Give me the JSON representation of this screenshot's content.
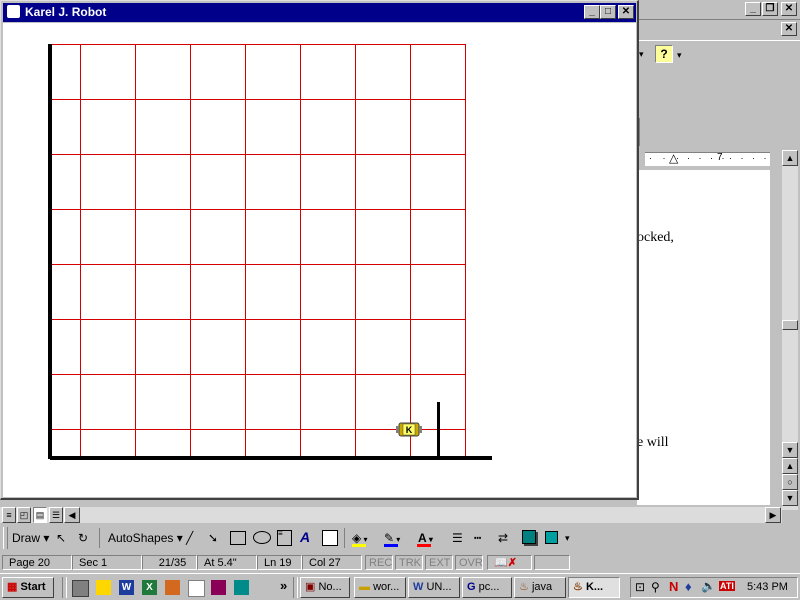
{
  "karel_window": {
    "title": "Karel J. Robot",
    "controls": {
      "minimize": "_",
      "maximize": "□",
      "close": "✕"
    }
  },
  "word_window": {
    "doc_fragments": [
      "ocked,",
      "e will"
    ],
    "ruler_number": "7",
    "help_icon": "?"
  },
  "draw_toolbar": {
    "draw_label": "Draw",
    "autoshapes_label": "AutoShapes"
  },
  "status_bar": {
    "page": "Page 20",
    "sec": "Sec 1",
    "pages": "21/35",
    "at": "At 5.4\"",
    "ln": "Ln 19",
    "col": "Col 27",
    "rec": "REC",
    "trk": "TRK",
    "ext": "EXT",
    "ovr": "OVR"
  },
  "taskbar": {
    "start_label": "Start",
    "overflow": "»",
    "tasks": [
      "No...",
      "wor...",
      "UN...",
      "pc...",
      "java",
      "K..."
    ],
    "clock": "5:43 PM"
  }
}
